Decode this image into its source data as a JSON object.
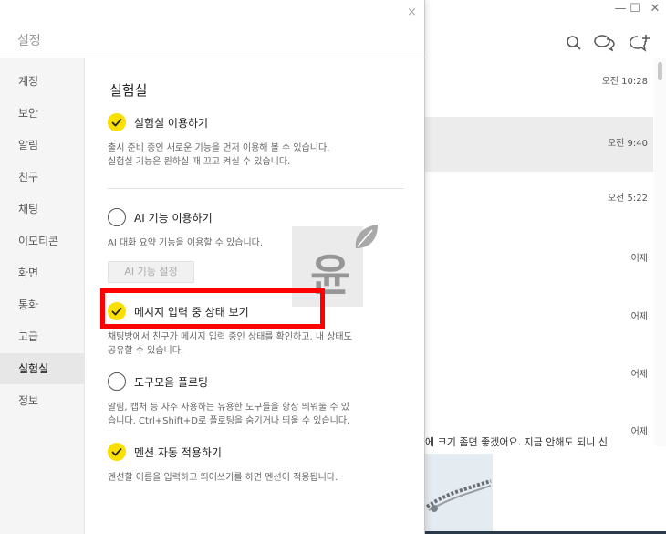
{
  "settings": {
    "title": "설정",
    "close_glyph": "×",
    "nav": [
      "계정",
      "보안",
      "알림",
      "친구",
      "채팅",
      "이모티콘",
      "화면",
      "통화",
      "고급",
      "실험실",
      "정보"
    ],
    "active_nav": "실험실",
    "section_title": "실험실",
    "options": {
      "lab": {
        "label": "실험실 이용하기",
        "checked": true,
        "desc": "출시 준비 중인 새로운 기능을 먼저 이용해 볼 수 있습니다.\n실험실 기능은 원하실 때 끄고 켜실 수 있습니다."
      },
      "ai": {
        "label": "AI 기능 이용하기",
        "checked": false,
        "desc": "AI 대화 요약 기능을 이용할 수 있습니다.",
        "button": "AI 기능 설정"
      },
      "typing": {
        "label": "메시지 입력 중 상태 보기",
        "checked": true,
        "desc": "채팅방에서 친구가 메시지 입력 중인 상태를 확인하고, 내 상태도\n공유할 수 있습니다."
      },
      "floating": {
        "label": "도구모음 플로팅",
        "checked": false,
        "desc": "알림, 캡처 등 자주 사용하는 유용한 도구들을 항상 띄워둘 수 있\n습니다. Ctrl+Shift+D로 플로팅을 숨기거나 띄울 수 있습니다."
      },
      "mention": {
        "label": "멘션 자동 적용하기",
        "checked": true,
        "desc": "멘션할 이름을 입력하고 띄어쓰기를 하면 멘션이 적용됩니다."
      }
    }
  },
  "chat": {
    "window_controls": [
      "—",
      "☐",
      "✕"
    ],
    "toolbar_icons": [
      "search-icon",
      "chat-bubbles-icon",
      "new-chat-icon"
    ],
    "times": [
      "오전 10:28",
      "오전 9:40",
      "오전 5:22",
      "어제",
      "어제",
      "어제",
      "어제"
    ],
    "selected_index": 1,
    "preview_text": "에 크기 좀면 좋겠어요. 지금 안해도 되니 신"
  },
  "watermark": {
    "glyph": "윤"
  },
  "colors": {
    "accent_yellow": "#f9e000",
    "highlight_red": "#ff0000"
  }
}
